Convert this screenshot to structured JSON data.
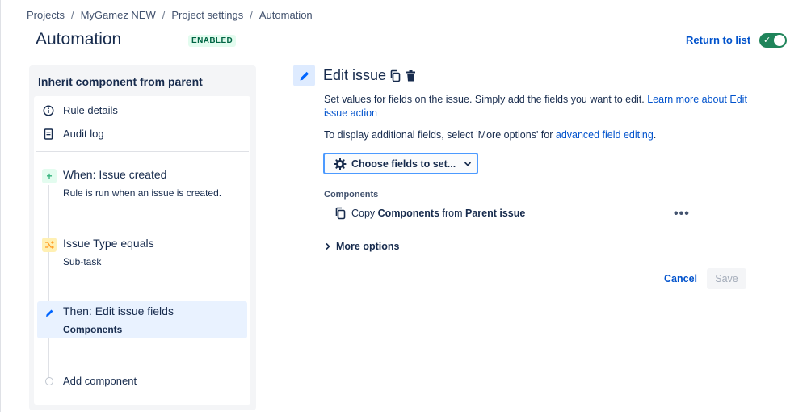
{
  "breadcrumb": [
    "Projects",
    "MyGamez NEW",
    "Project settings",
    "Automation"
  ],
  "header": {
    "title": "Automation",
    "status": "ENABLED",
    "return_link": "Return to list",
    "toggle_on": true
  },
  "sidebar": {
    "title": "Inherit component from parent",
    "nav": [
      {
        "label": "Rule details",
        "icon": "info-icon"
      },
      {
        "label": "Audit log",
        "icon": "document-icon"
      }
    ],
    "steps": [
      {
        "title": "When: Issue created",
        "subtitle": "Rule is run when an issue is created.",
        "icon": "plus-icon",
        "color": "#36b37e"
      },
      {
        "title": "Issue Type equals",
        "subtitle": "Sub-task",
        "icon": "shuffle-icon",
        "color": "#ff991f"
      },
      {
        "title": "Then: Edit issue fields",
        "subtitle": "Components",
        "icon": "pencil-icon",
        "color": "#0065ff",
        "selected": true
      }
    ],
    "add_component": "Add component"
  },
  "main": {
    "title": "Edit issue",
    "desc1_text": "Set values for fields on the issue. Simply add the fields you want to edit. ",
    "desc1_link": "Learn more about Edit issue action",
    "desc2_text": "To display additional fields, select 'More options' for ",
    "desc2_link": "advanced field editing",
    "desc2_end": ".",
    "choose_button": "Choose fields to set...",
    "field_label": "Components",
    "copy": {
      "prefix": "Copy ",
      "field": "Components",
      "mid": " from ",
      "source": "Parent issue"
    },
    "more_options": "More options",
    "cancel": "Cancel",
    "save": "Save"
  },
  "colors": {
    "accent": "#0052cc",
    "toggle": "#1f845a",
    "badge_bg": "#e3fcef",
    "badge_text": "#006644"
  }
}
